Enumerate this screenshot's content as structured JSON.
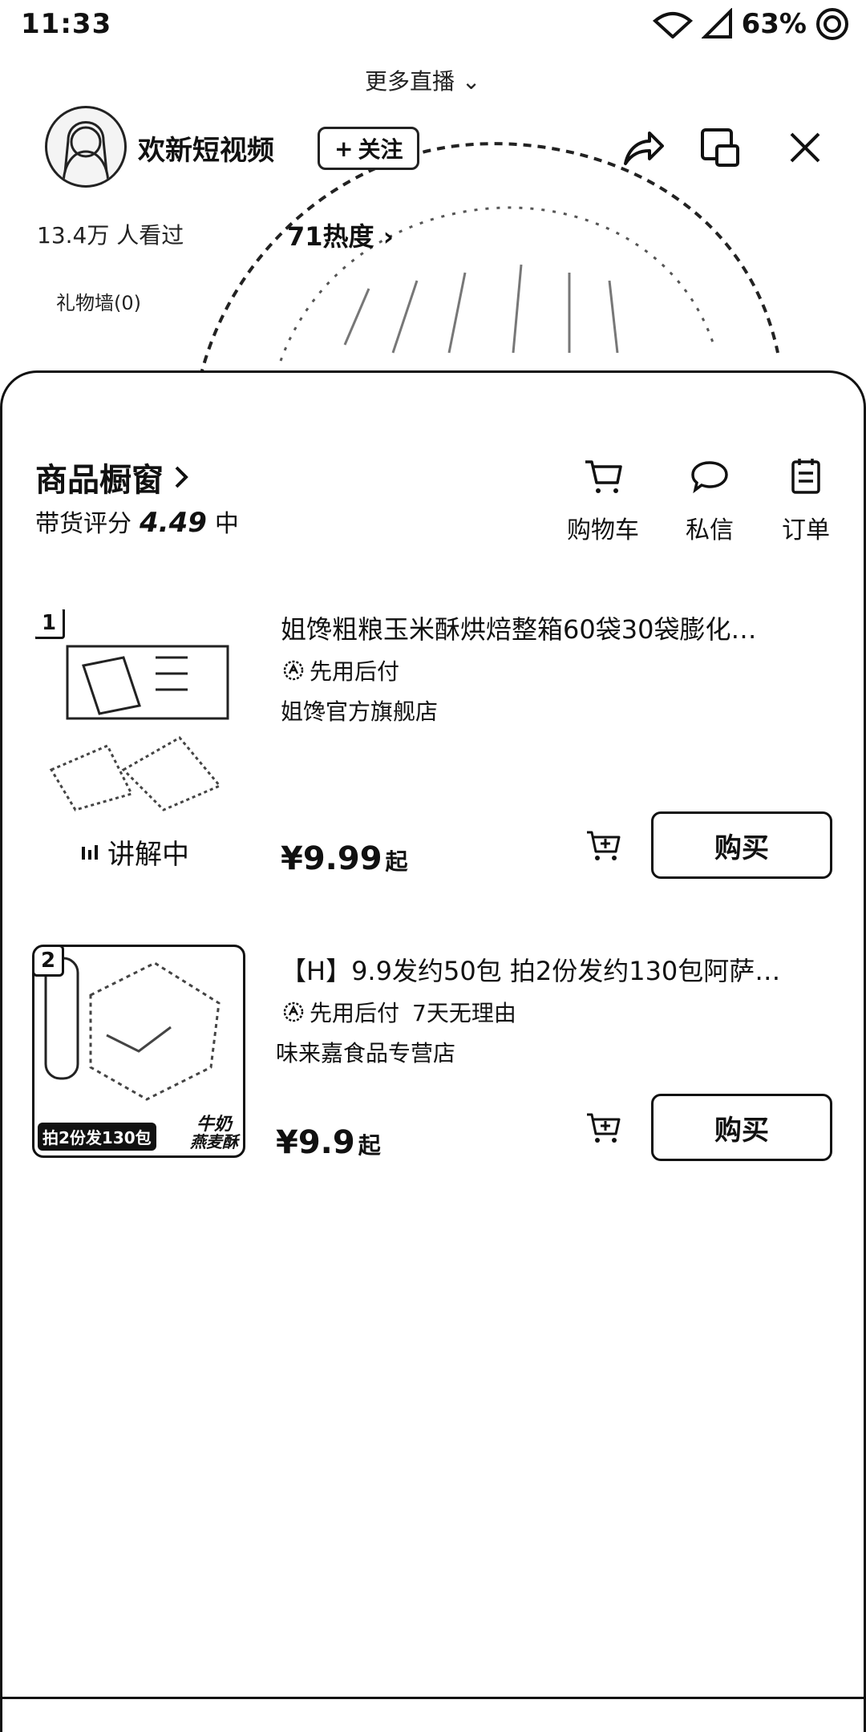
{
  "status_bar": {
    "time": "11:33",
    "battery": "63%"
  },
  "live": {
    "more_live": "更多直播",
    "host_name": "欢新短视频",
    "follow_label": "关注",
    "viewers_text": "13.4万 人看过",
    "hot_text": "71热度",
    "gift_wall": "礼物墙(0)"
  },
  "sheet": {
    "title": "商品橱窗",
    "rating_label": "带货评分",
    "rating_value": "4.49",
    "rating_level": "中",
    "actions": [
      {
        "label": "购物车",
        "icon": "cart-icon"
      },
      {
        "label": "私信",
        "icon": "message-icon"
      },
      {
        "label": "订单",
        "icon": "order-icon"
      }
    ]
  },
  "products": [
    {
      "rank": "1",
      "title": "姐馋粗粮玉米酥烘焙整箱60袋30袋膨化…",
      "tags": [
        "先用后付"
      ],
      "shop": "姐馋官方旗舰店",
      "price": "¥9.99",
      "price_suffix": "起",
      "status": "讲解中",
      "buy_label": "购买"
    },
    {
      "rank": "2",
      "title": "【H】9.9发约50包 拍2份发约130包阿萨…",
      "tags": [
        "先用后付",
        "7天无理由"
      ],
      "shop": "味来嘉食品专营店",
      "price": "¥9.9",
      "price_suffix": "起",
      "thumb_caption_left": "拍2份发130包",
      "thumb_caption_right_1": "牛奶",
      "thumb_caption_right_2": "燕麦酥",
      "buy_label": "购买"
    }
  ]
}
